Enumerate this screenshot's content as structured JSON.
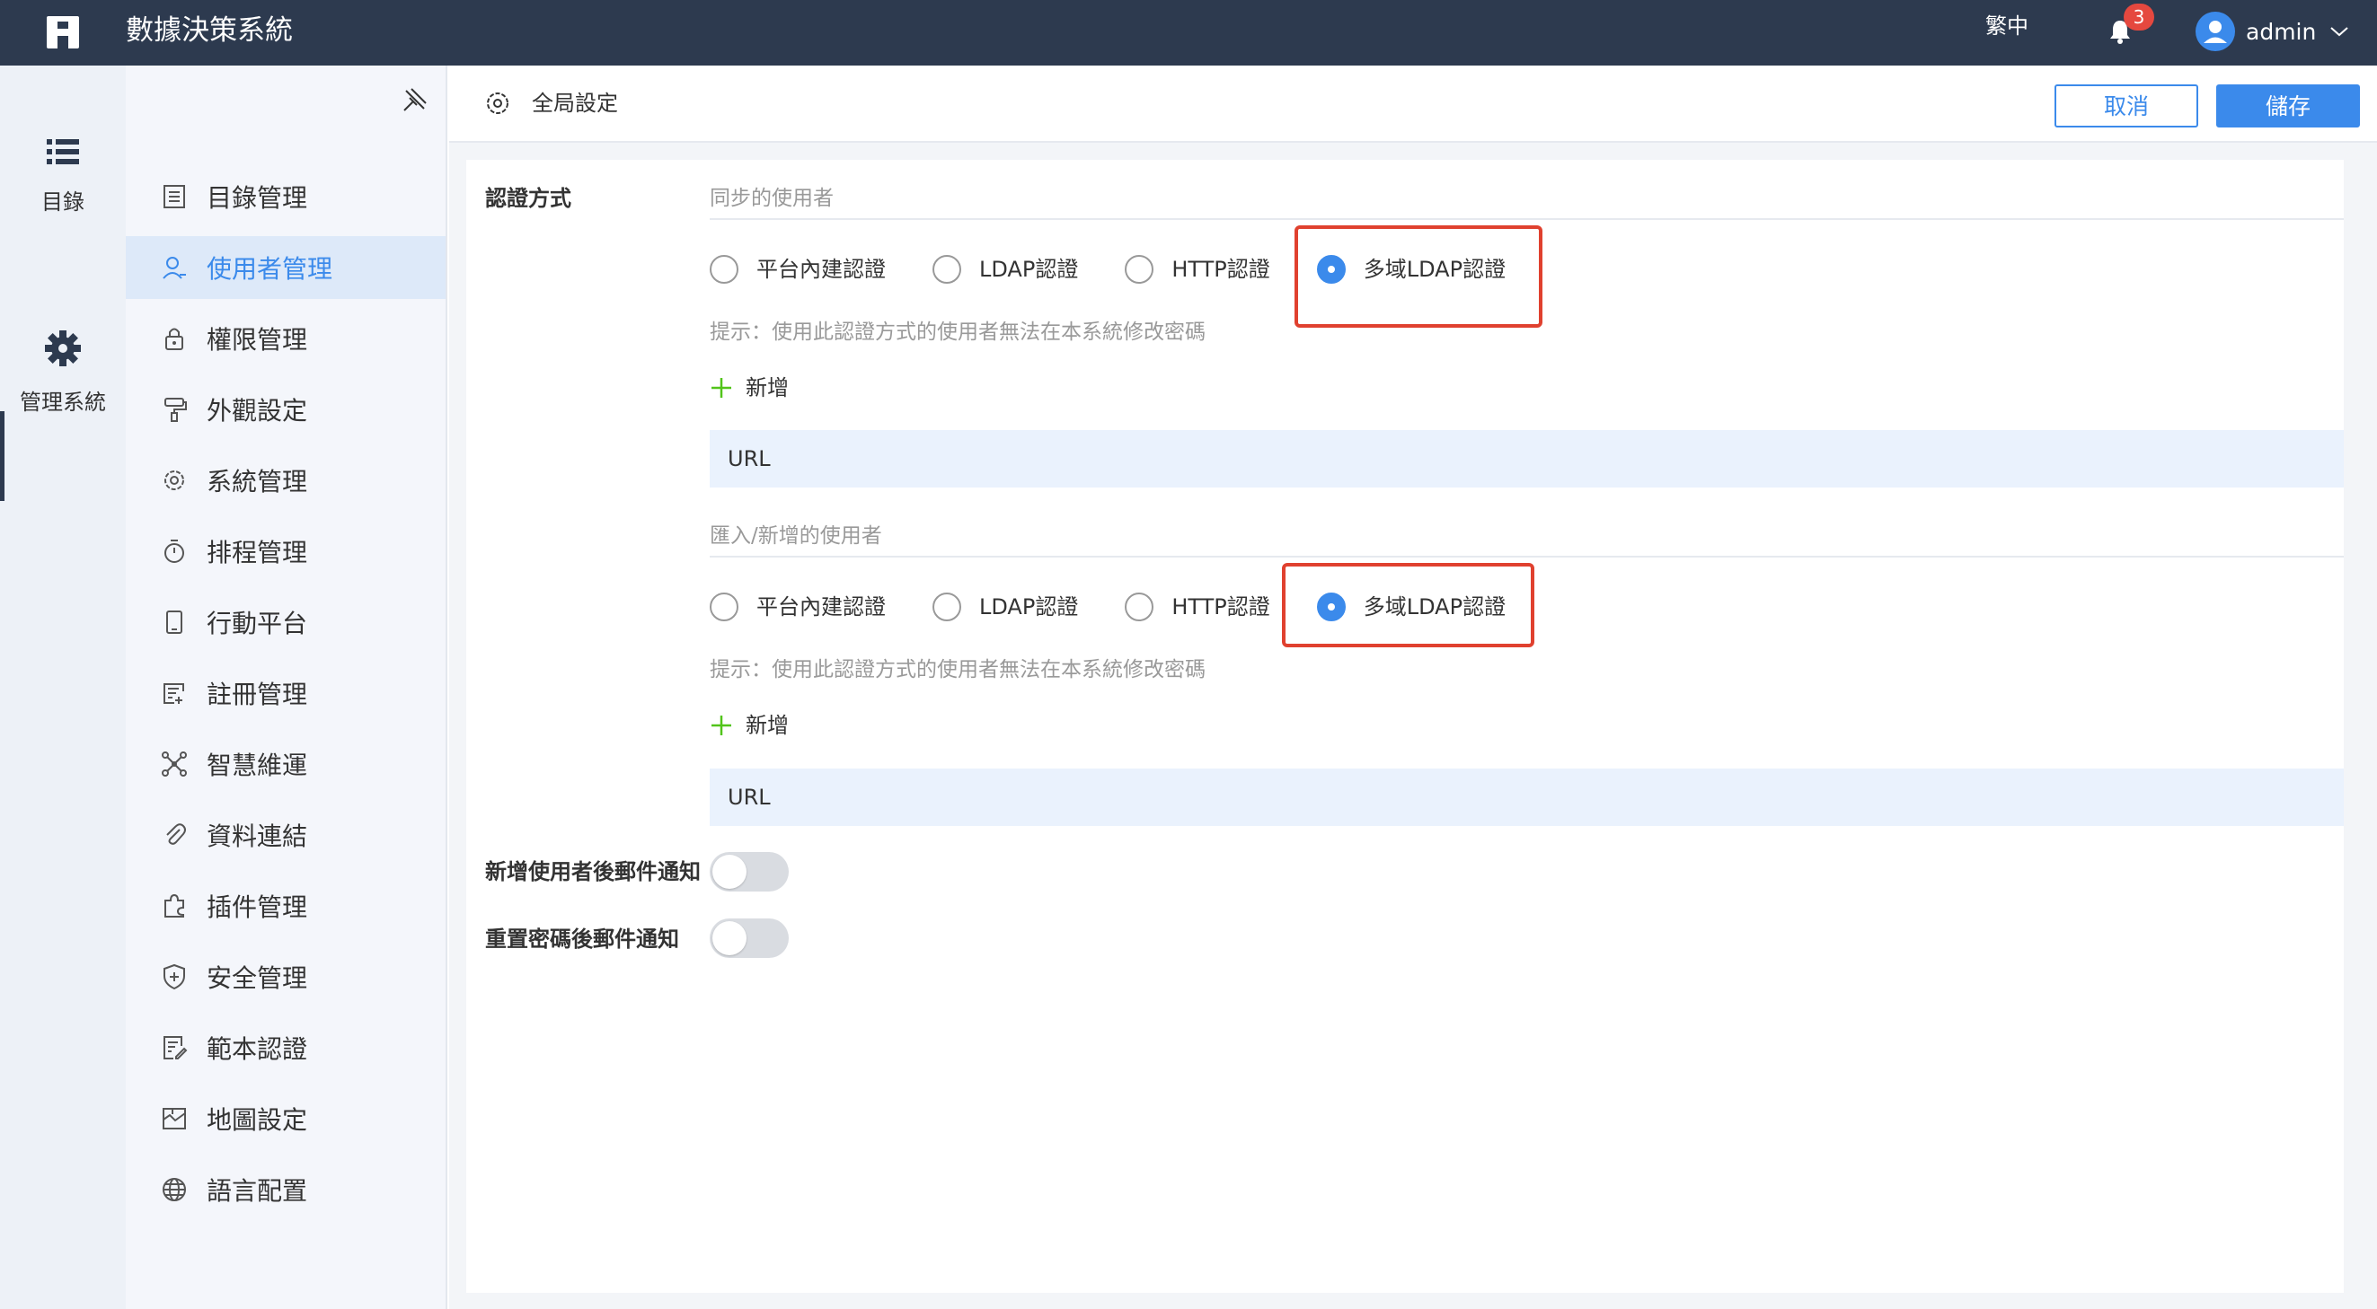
{
  "topbar": {
    "app_title": "數據決策系統",
    "language": "繁中",
    "notification_count": "3",
    "username": "admin"
  },
  "rail": {
    "items": [
      {
        "label": "目錄",
        "icon": "list-icon"
      },
      {
        "label": "管理系統",
        "icon": "gear-icon"
      }
    ]
  },
  "nav": {
    "items": [
      {
        "label": "目錄管理",
        "icon": "catalog-icon"
      },
      {
        "label": "使用者管理",
        "icon": "user-icon"
      },
      {
        "label": "權限管理",
        "icon": "lock-icon"
      },
      {
        "label": "外觀設定",
        "icon": "paint-roller-icon"
      },
      {
        "label": "系統管理",
        "icon": "gear-icon"
      },
      {
        "label": "排程管理",
        "icon": "stopwatch-icon"
      },
      {
        "label": "行動平台",
        "icon": "tablet-icon"
      },
      {
        "label": "註冊管理",
        "icon": "register-icon"
      },
      {
        "label": "智慧維運",
        "icon": "network-icon"
      },
      {
        "label": "資料連結",
        "icon": "paperclip-icon"
      },
      {
        "label": "插件管理",
        "icon": "puzzle-icon"
      },
      {
        "label": "安全管理",
        "icon": "shield-icon"
      },
      {
        "label": "範本認證",
        "icon": "template-icon"
      },
      {
        "label": "地圖設定",
        "icon": "map-icon"
      },
      {
        "label": "語言配置",
        "icon": "globe-icon"
      }
    ],
    "active_index": 1
  },
  "header": {
    "title": "全局設定",
    "cancel_label": "取消",
    "save_label": "儲存"
  },
  "auth": {
    "section_label": "認證方式",
    "sync_group": {
      "title": "同步的使用者",
      "options": [
        "平台內建認證",
        "LDAP認證",
        "HTTP認證",
        "多域LDAP認證"
      ],
      "selected": "多域LDAP認證",
      "hint": "提示：使用此認證方式的使用者無法在本系統修改密碼",
      "add_label": "新增",
      "url_label": "URL"
    },
    "import_group": {
      "title": "匯入/新增的使用者",
      "options": [
        "平台內建認證",
        "LDAP認證",
        "HTTP認證",
        "多域LDAP認證"
      ],
      "selected": "多域LDAP認證",
      "hint": "提示：使用此認證方式的使用者無法在本系統修改密碼",
      "add_label": "新增",
      "url_label": "URL"
    }
  },
  "switches": [
    {
      "label": "新增使用者後郵件通知",
      "on": false
    },
    {
      "label": "重置密碼後郵件通知",
      "on": false
    }
  ],
  "colors": {
    "topbar": "#2d3a4f",
    "accent": "#3b8aeb",
    "highlight": "#e0412f",
    "badge": "#e5483f"
  }
}
